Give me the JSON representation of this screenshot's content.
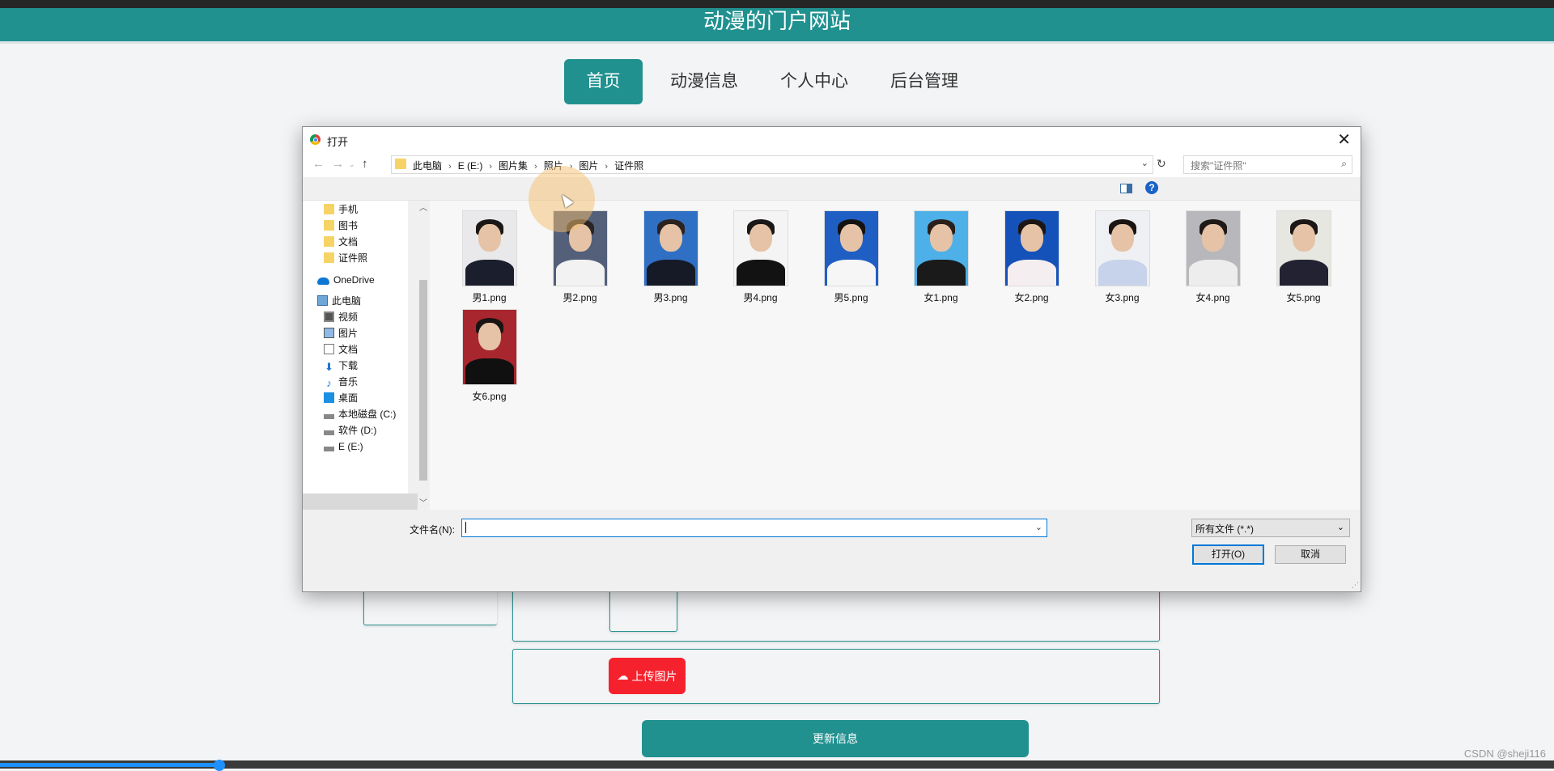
{
  "site": {
    "title": "动漫的门户网站",
    "nav": [
      {
        "label": "首页",
        "active": true
      },
      {
        "label": "动漫信息",
        "active": false
      },
      {
        "label": "个人中心",
        "active": false
      },
      {
        "label": "后台管理",
        "active": false
      }
    ],
    "upload_label": "上传图片",
    "update_label": "更新信息",
    "watermark": "CSDN @sheji116"
  },
  "dialog": {
    "title": "打开",
    "breadcrumbs": [
      "此电脑",
      "E (E:)",
      "图片集",
      "照片",
      "图片",
      "证件照"
    ],
    "search_placeholder": "搜索\"证件照\"",
    "nav_pane": [
      {
        "label": "手机",
        "icon": "folder-icon"
      },
      {
        "label": "图书",
        "icon": "folder-icon"
      },
      {
        "label": "文档",
        "icon": "folder-icon"
      },
      {
        "label": "证件照",
        "icon": "folder-icon"
      },
      {
        "label": "OneDrive",
        "icon": "onedrive-icon"
      },
      {
        "label": "此电脑",
        "icon": "computer-icon"
      },
      {
        "label": "视频",
        "icon": "video-icon"
      },
      {
        "label": "图片",
        "icon": "pictures-icon"
      },
      {
        "label": "文档",
        "icon": "documents-icon"
      },
      {
        "label": "下载",
        "icon": "download-icon"
      },
      {
        "label": "音乐",
        "icon": "music-icon"
      },
      {
        "label": "桌面",
        "icon": "desktop-icon"
      },
      {
        "label": "本地磁盘 (C:)",
        "icon": "drive-icon"
      },
      {
        "label": "软件 (D:)",
        "icon": "drive-icon"
      },
      {
        "label": "E (E:)",
        "icon": "drive-icon"
      }
    ],
    "files": [
      {
        "name": "男1.png",
        "bg": "#e9e9ec",
        "body": "#1b1e2c",
        "hair": "#1a1715"
      },
      {
        "name": "男2.png",
        "bg": "#54607a",
        "body": "#f2f2f2",
        "hair": "#2a2522"
      },
      {
        "name": "男3.png",
        "bg": "#2f6fc4",
        "body": "#161a26",
        "hair": "#2b2320"
      },
      {
        "name": "男4.png",
        "bg": "#f4f4f4",
        "body": "#121212",
        "hair": "#1b1818"
      },
      {
        "name": "男5.png",
        "bg": "#1f5fc4",
        "body": "#f6f6f6",
        "hair": "#151312"
      },
      {
        "name": "女1.png",
        "bg": "#4db0e8",
        "body": "#1a1a1a",
        "hair": "#2a1f1a"
      },
      {
        "name": "女2.png",
        "bg": "#1451b8",
        "body": "#f5eef0",
        "hair": "#1c1614"
      },
      {
        "name": "女3.png",
        "bg": "#eef0f4",
        "body": "#c7d3ea",
        "hair": "#1a1513"
      },
      {
        "name": "女4.png",
        "bg": "#b8b8bc",
        "body": "#ededed",
        "hair": "#1f1a18"
      },
      {
        "name": "女5.png",
        "bg": "#e6e7e1",
        "body": "#222233",
        "hair": "#1c1716"
      },
      {
        "name": "女6.png",
        "bg": "#a8262d",
        "body": "#101010",
        "hair": "#191413"
      }
    ],
    "filename_label": "文件名(N):",
    "filename_value": "",
    "filetype": "所有文件 (*.*)",
    "open_label": "打开(O)",
    "cancel_label": "取消"
  }
}
